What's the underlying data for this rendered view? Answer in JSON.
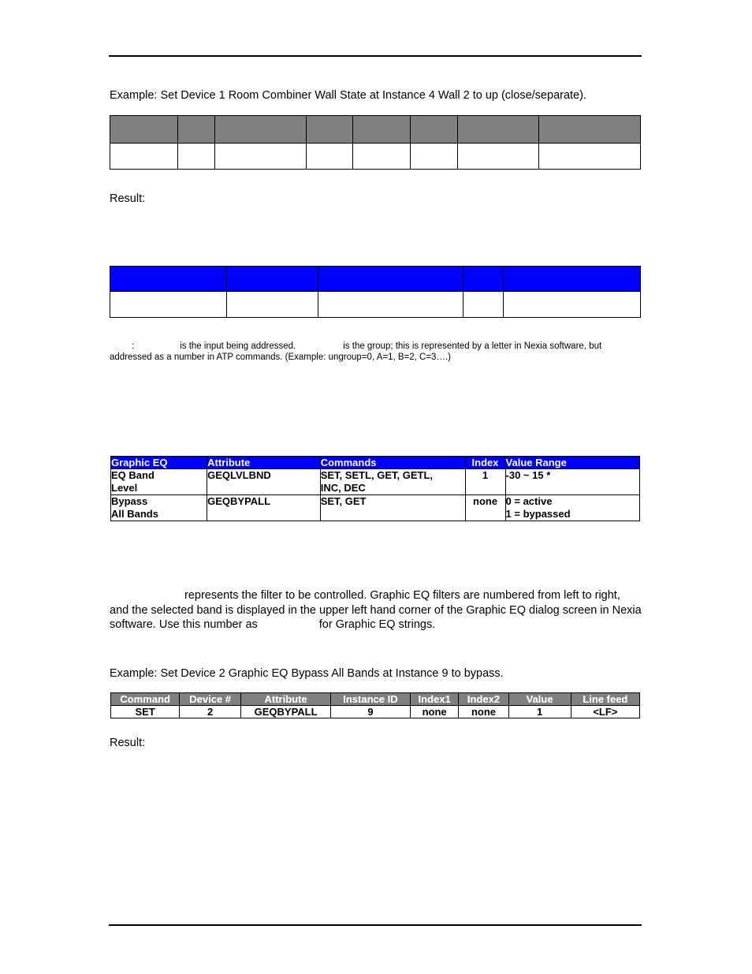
{
  "document": {
    "example_1": "Example: Set Device 1 Room Combiner Wall State at Instance 4 Wall 2 to up (close/separate).",
    "result_1": "Result:",
    "result_2": "Result:",
    "footnote": {
      "part1": ":",
      "part2": "is the input being addressed.",
      "part3": "is the group; this is represented by a letter in Nexia software, but addressed as a number in ATP commands. (Example: ungroup=0, A=1, B=2, C=3….)"
    },
    "paragraph": {
      "part1": "represents the filter to be controlled. Graphic EQ filters are numbered from left to right, and the selected band is displayed in the upper left hand corner of the Graphic EQ dialog screen in Nexia software. Use this number as",
      "part2": "for Graphic EQ strings."
    },
    "example_2": "Example: Set Device 2 Graphic EQ Bypass All Bands at Instance 9 to bypass."
  },
  "blank_table_gray": {
    "column_count": 8,
    "header_cells": [
      "",
      "",
      "",
      "",
      "",
      "",
      "",
      ""
    ],
    "data_cells": [
      "",
      "",
      "",
      "",
      "",
      "",
      "",
      ""
    ],
    "header_color": "#808080",
    "widths": [
      "12.8%",
      "7.0%",
      "17.2%",
      "8.8%",
      "10.8%",
      "9.0%",
      "15.2%",
      "19.2%"
    ]
  },
  "blank_table_blue": {
    "column_count": 5,
    "header_cells": [
      "",
      "",
      "",
      "",
      ""
    ],
    "data_cells": [
      "",
      "",
      "",
      "",
      ""
    ],
    "header_color": "#0000ff",
    "widths": [
      "22.0%",
      "17.3%",
      "27.2%",
      "7.6%",
      "25.9%"
    ]
  },
  "graphic_eq_table": {
    "header_color": "#0000ff",
    "headers": [
      "Graphic EQ",
      "Attribute",
      "Commands",
      "Index",
      "Value Range"
    ],
    "widths": [
      "18.2%",
      "21.4%",
      "27.4%",
      "7.6%",
      "25.4%"
    ],
    "rows": [
      {
        "name": [
          "EQ Band",
          "Level"
        ],
        "attribute": [
          "GEQLVLBND",
          ""
        ],
        "commands": [
          "SET, SETL, GET, GETL,",
          "INC, DEC"
        ],
        "index": [
          "1",
          ""
        ],
        "value_range": [
          "-30 ~ 15 *",
          ""
        ]
      },
      {
        "name": [
          "Bypass",
          "All Bands"
        ],
        "attribute": [
          "GEQBYPALL",
          ""
        ],
        "commands": [
          "SET, GET",
          ""
        ],
        "index": [
          "none",
          ""
        ],
        "value_range": [
          "0 = active",
          "1 = bypassed"
        ]
      }
    ]
  },
  "command_table": {
    "header_color": "#808080",
    "headers": [
      "Command",
      "Device #",
      "Attribute",
      "Instance ID",
      "Index1",
      "Index2",
      "Value",
      "Line feed"
    ],
    "values": [
      "SET",
      "2",
      "GEQBYPALL",
      "9",
      "none",
      "none",
      "1",
      "<LF>"
    ],
    "widths": [
      "13.0%",
      "11.6%",
      "17.0%",
      "15.0%",
      "9.2%",
      "9.4%",
      "11.8%",
      "13.0%"
    ]
  }
}
